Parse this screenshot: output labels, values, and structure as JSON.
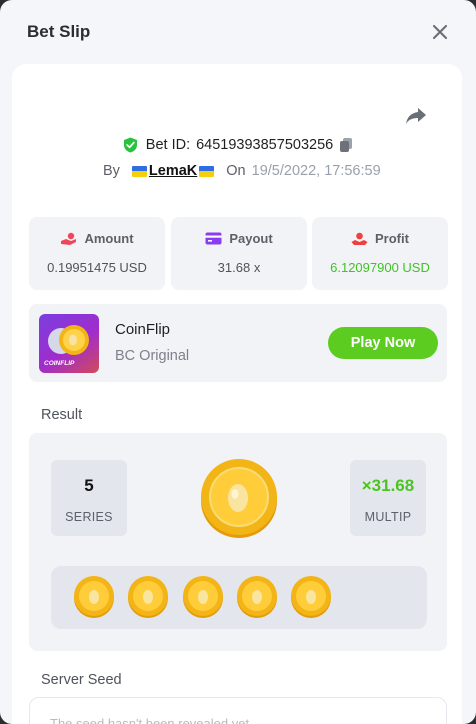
{
  "modal": {
    "title": "Bet Slip"
  },
  "bet": {
    "id_label": "Bet ID:",
    "id_value": "64519393857503256",
    "by_label": "By",
    "user": "LemaK",
    "on_label": "On",
    "date": "19/5/2022, 17:56:59"
  },
  "stats": [
    {
      "label": "Amount",
      "value": "0.19951475 USD",
      "icon": "hand-coins-icon"
    },
    {
      "label": "Payout",
      "value": "31.68 x",
      "icon": "card-icon"
    },
    {
      "label": "Profit",
      "value": "6.12097900 USD",
      "icon": "profit-hand-icon"
    }
  ],
  "game": {
    "thumb_label": "COINFLIP",
    "name": "CoinFlip",
    "provider": "BC Original",
    "play_label": "Play Now"
  },
  "result": {
    "section_label": "Result",
    "series_value": "5",
    "series_label": "SERIES",
    "multiplier_value": "×31.68",
    "multiplier_label": "MULTIP",
    "coin_count": 5
  },
  "server_seed": {
    "label": "Server Seed",
    "text": "The seed hasn't been revealed yet"
  },
  "colors": {
    "accent_green": "#5ccd20",
    "profit_green": "#3fc424",
    "coin_gold": "#f3b416",
    "modal_bg": "#f5f6fa"
  },
  "icons": {
    "close": "close-icon",
    "share": "share-icon",
    "verified": "shield-check-icon",
    "copy": "copy-icon",
    "coin": "coin-icon"
  }
}
